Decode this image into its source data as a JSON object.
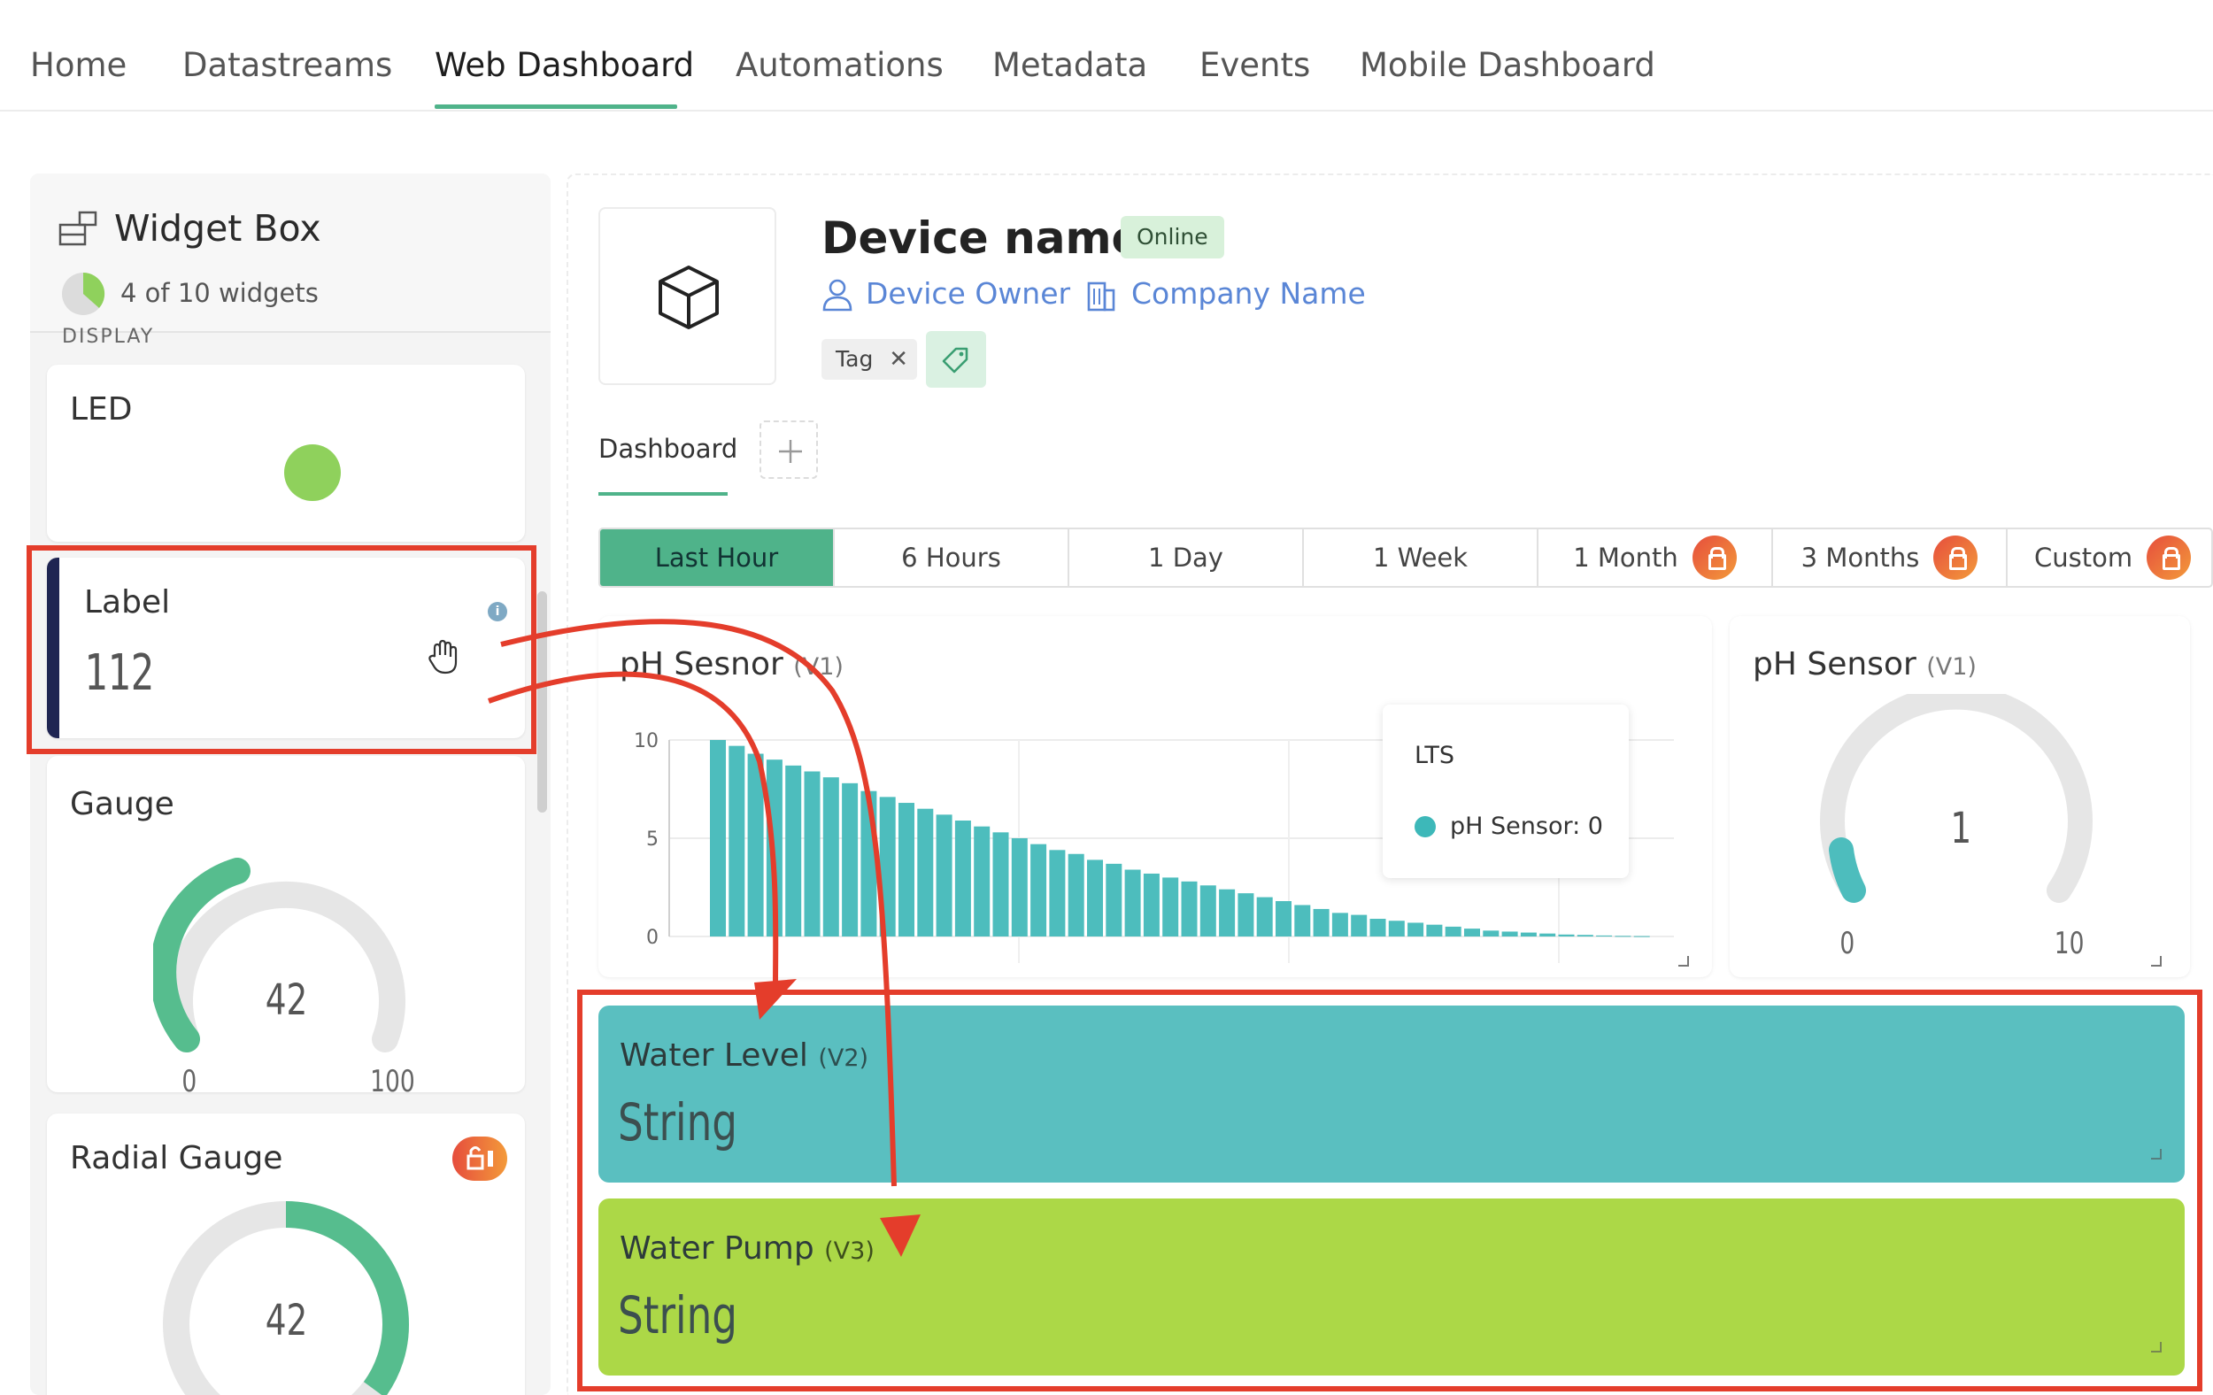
{
  "nav": {
    "tabs": [
      {
        "label": "Home"
      },
      {
        "label": "Datastreams"
      },
      {
        "label": "Web Dashboard"
      },
      {
        "label": "Automations"
      },
      {
        "label": "Metadata"
      },
      {
        "label": "Events"
      },
      {
        "label": "Mobile Dashboard"
      }
    ],
    "active_index": 2
  },
  "widget_box": {
    "title": "Widget Box",
    "count": "4 of 10 widgets",
    "section": "DISPLAY",
    "widgets": [
      {
        "title": "LED",
        "led_color": "#8fd15c"
      },
      {
        "title": "Label",
        "value": "112"
      },
      {
        "title": "Gauge",
        "value": "42",
        "min": "0",
        "max": "100"
      },
      {
        "title": "Radial Gauge",
        "value": "42"
      }
    ]
  },
  "device": {
    "name": "Device name",
    "status": "Online",
    "owner": "Device Owner",
    "company": "Company Name",
    "tag": "Tag"
  },
  "dashboard_tabs": {
    "active": "Dashboard"
  },
  "time_ranges": [
    {
      "label": "Last Hour",
      "active": true,
      "locked": false
    },
    {
      "label": "6 Hours",
      "active": false,
      "locked": false
    },
    {
      "label": "1 Day",
      "active": false,
      "locked": false
    },
    {
      "label": "1 Week",
      "active": false,
      "locked": false
    },
    {
      "label": "1 Month",
      "active": false,
      "locked": true
    },
    {
      "label": "3 Months",
      "active": false,
      "locked": true
    },
    {
      "label": "Custom",
      "active": false,
      "locked": true
    }
  ],
  "chart_widget": {
    "title": "pH Sesnor",
    "pin": "(V1)",
    "legend_title": "LTS",
    "legend_entry": "pH Sensor: 0"
  },
  "chart_data": {
    "type": "bar",
    "title": "",
    "xlabel": "",
    "ylabel": "",
    "ylim": [
      0,
      10
    ],
    "yticks": [
      "0",
      "5",
      "10"
    ],
    "grid": true,
    "legend": "top-right",
    "series": [
      {
        "name": "pH Sensor",
        "color": "#4dbdbd",
        "values": [
          10,
          9.7,
          9.3,
          9.0,
          8.7,
          8.4,
          8.1,
          7.8,
          7.4,
          7.1,
          6.8,
          6.5,
          6.2,
          5.9,
          5.6,
          5.3,
          5.0,
          4.7,
          4.4,
          4.2,
          3.9,
          3.7,
          3.4,
          3.2,
          3.0,
          2.8,
          2.6,
          2.4,
          2.2,
          2.0,
          1.8,
          1.6,
          1.4,
          1.2,
          1.1,
          0.9,
          0.8,
          0.7,
          0.6,
          0.5,
          0.4,
          0.3,
          0.25,
          0.2,
          0.15,
          0.1,
          0.08,
          0.05,
          0.03,
          0.02
        ]
      }
    ]
  },
  "gauge_widget": {
    "title": "pH Sensor",
    "pin": "(V1)",
    "value": "1",
    "min": "0",
    "max": "10"
  },
  "value_widgets": [
    {
      "title": "Water Level",
      "pin": "(V2)",
      "value": "String",
      "color": "#5abfc0"
    },
    {
      "title": "Water Pump",
      "pin": "(V3)",
      "value": "String",
      "color": "#acd847"
    }
  ],
  "colors": {
    "accent": "#4fb38a",
    "annotation": "#e43d2b"
  }
}
